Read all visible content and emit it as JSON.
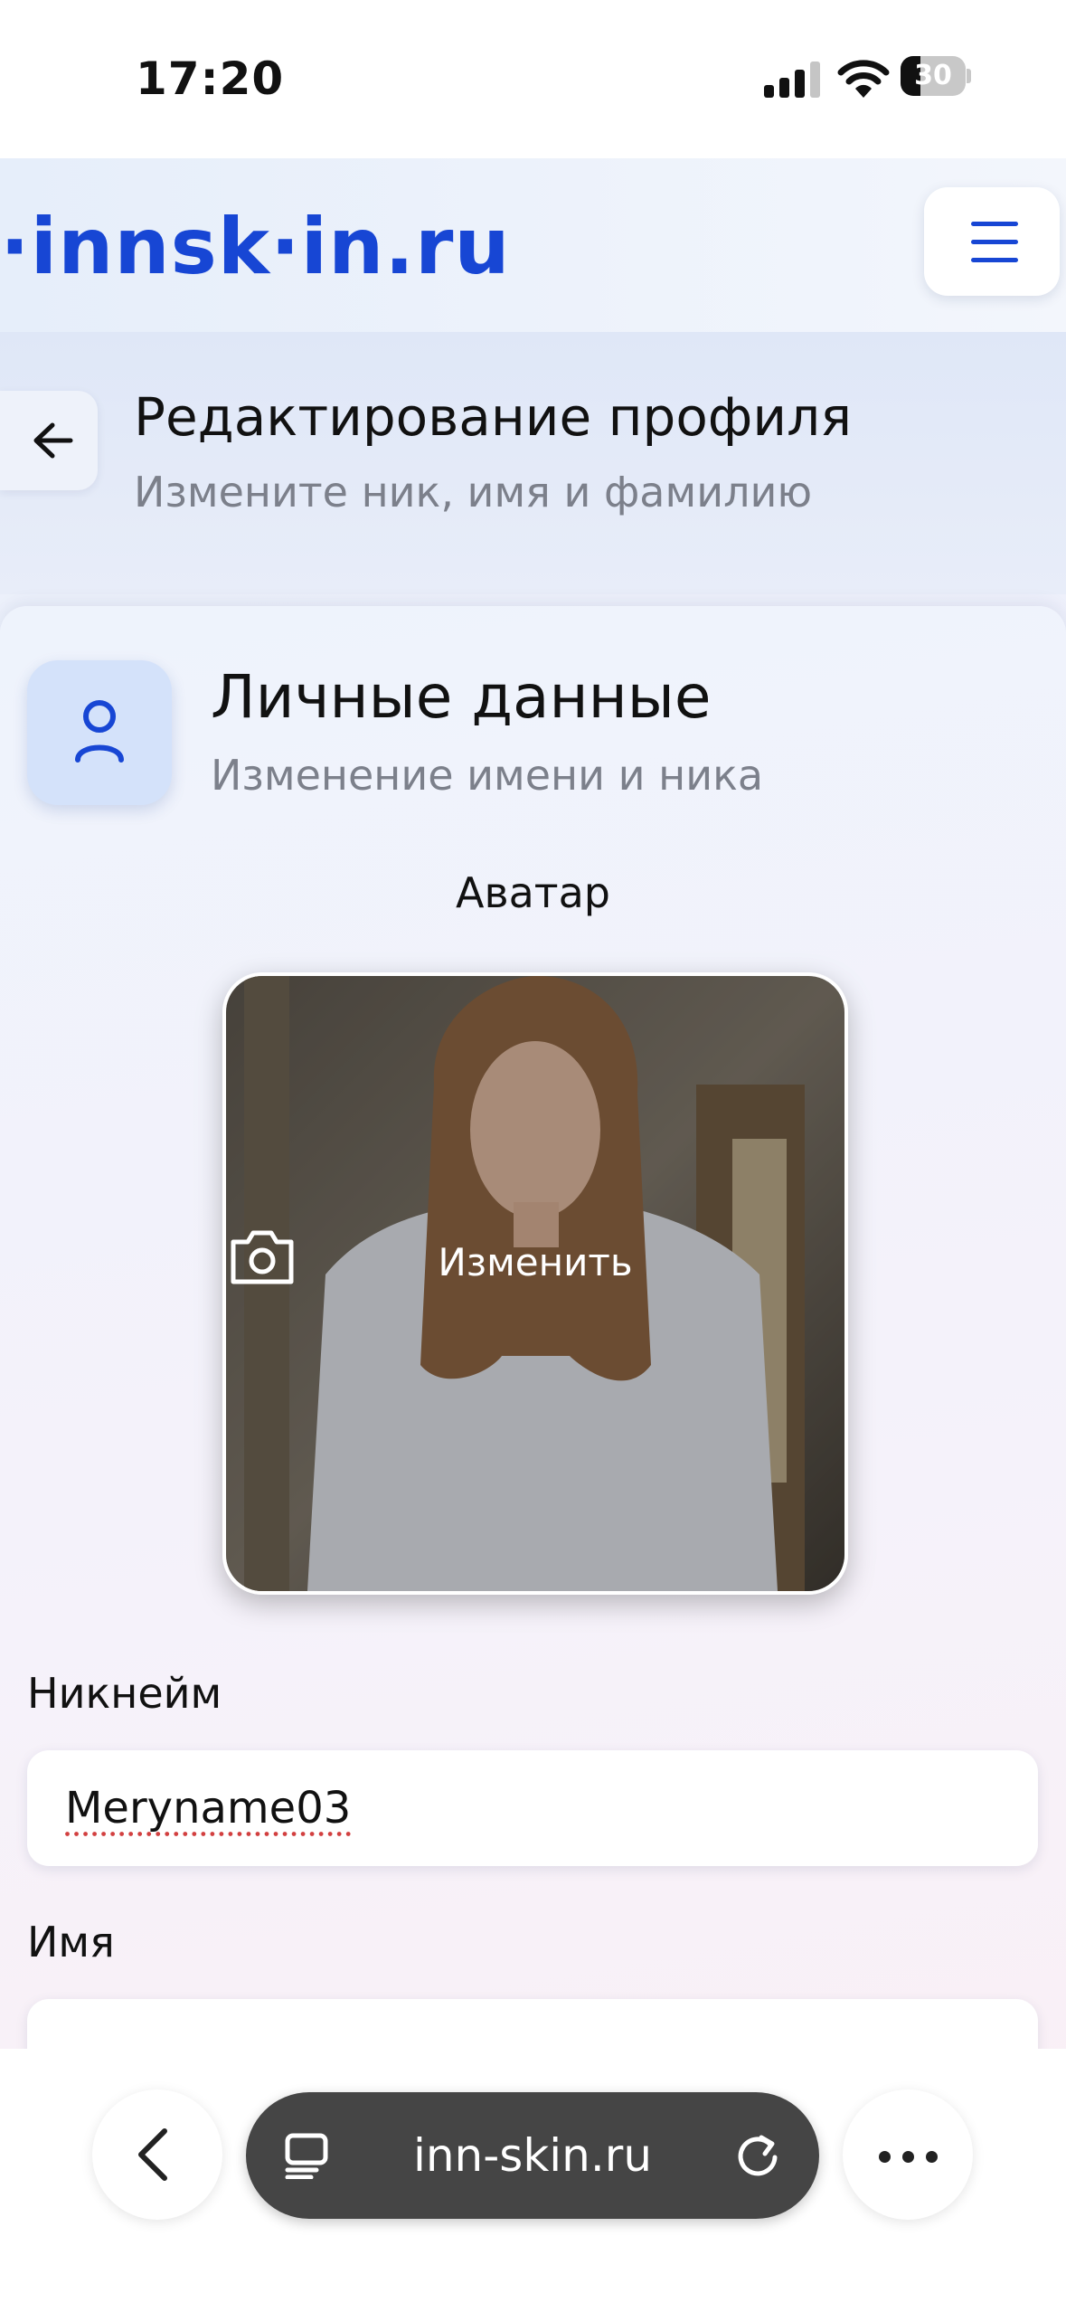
{
  "status_bar": {
    "time": "17:20",
    "battery": "30",
    "battery_level": 0.3
  },
  "header": {
    "logo": "·innsk·in.ru",
    "menu_icon": "hamburger-menu-icon"
  },
  "page_header": {
    "title": "Редактирование профиля",
    "subtitle": "Измените ник, имя и фамилию",
    "back_icon": "arrow-left-icon"
  },
  "section": {
    "icon": "user-icon",
    "title": "Личные данные",
    "subtitle": "Изменение имени и ника"
  },
  "avatar": {
    "label": "Аватар",
    "change_label": "Изменить",
    "change_icon": "camera-icon"
  },
  "fields": [
    {
      "label": "Никнейм",
      "value": "Meryname03"
    },
    {
      "label": "Имя",
      "value": ""
    }
  ],
  "browser": {
    "url": "inn-skin.ru",
    "back_icon": "chevron-left-icon",
    "tabs_icon": "tabs-icon",
    "reload_icon": "reload-icon",
    "more_icon": "more-dots-icon"
  },
  "colors": {
    "brand": "#1746d4",
    "muted": "#7c808b",
    "pill": "#454545"
  }
}
